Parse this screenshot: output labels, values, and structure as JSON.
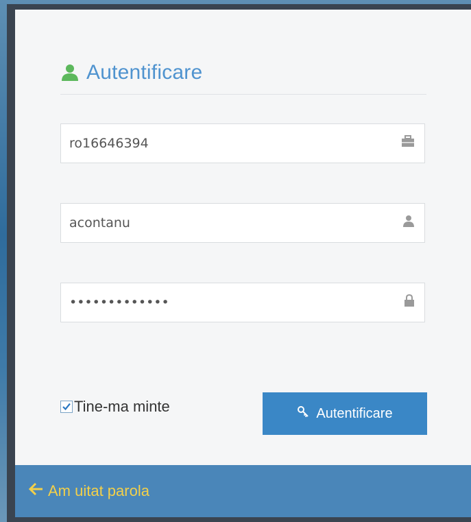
{
  "login": {
    "title": "Autentificare",
    "fields": {
      "company": {
        "value": "ro16646394",
        "icon": "briefcase-icon"
      },
      "username": {
        "value": "acontanu",
        "icon": "user-icon"
      },
      "password": {
        "value": "•••••••••••••",
        "icon": "lock-icon"
      }
    },
    "remember_label": "Tine-ma minte",
    "remember_checked": true,
    "submit_label": "Autentificare",
    "forgot_label": "Am uitat parola"
  },
  "colors": {
    "accent": "#3a87c6",
    "title": "#4f93cf",
    "user_icon": "#5cb85c",
    "footer_bg": "#4a86b9",
    "footer_link": "#f3d04a"
  }
}
